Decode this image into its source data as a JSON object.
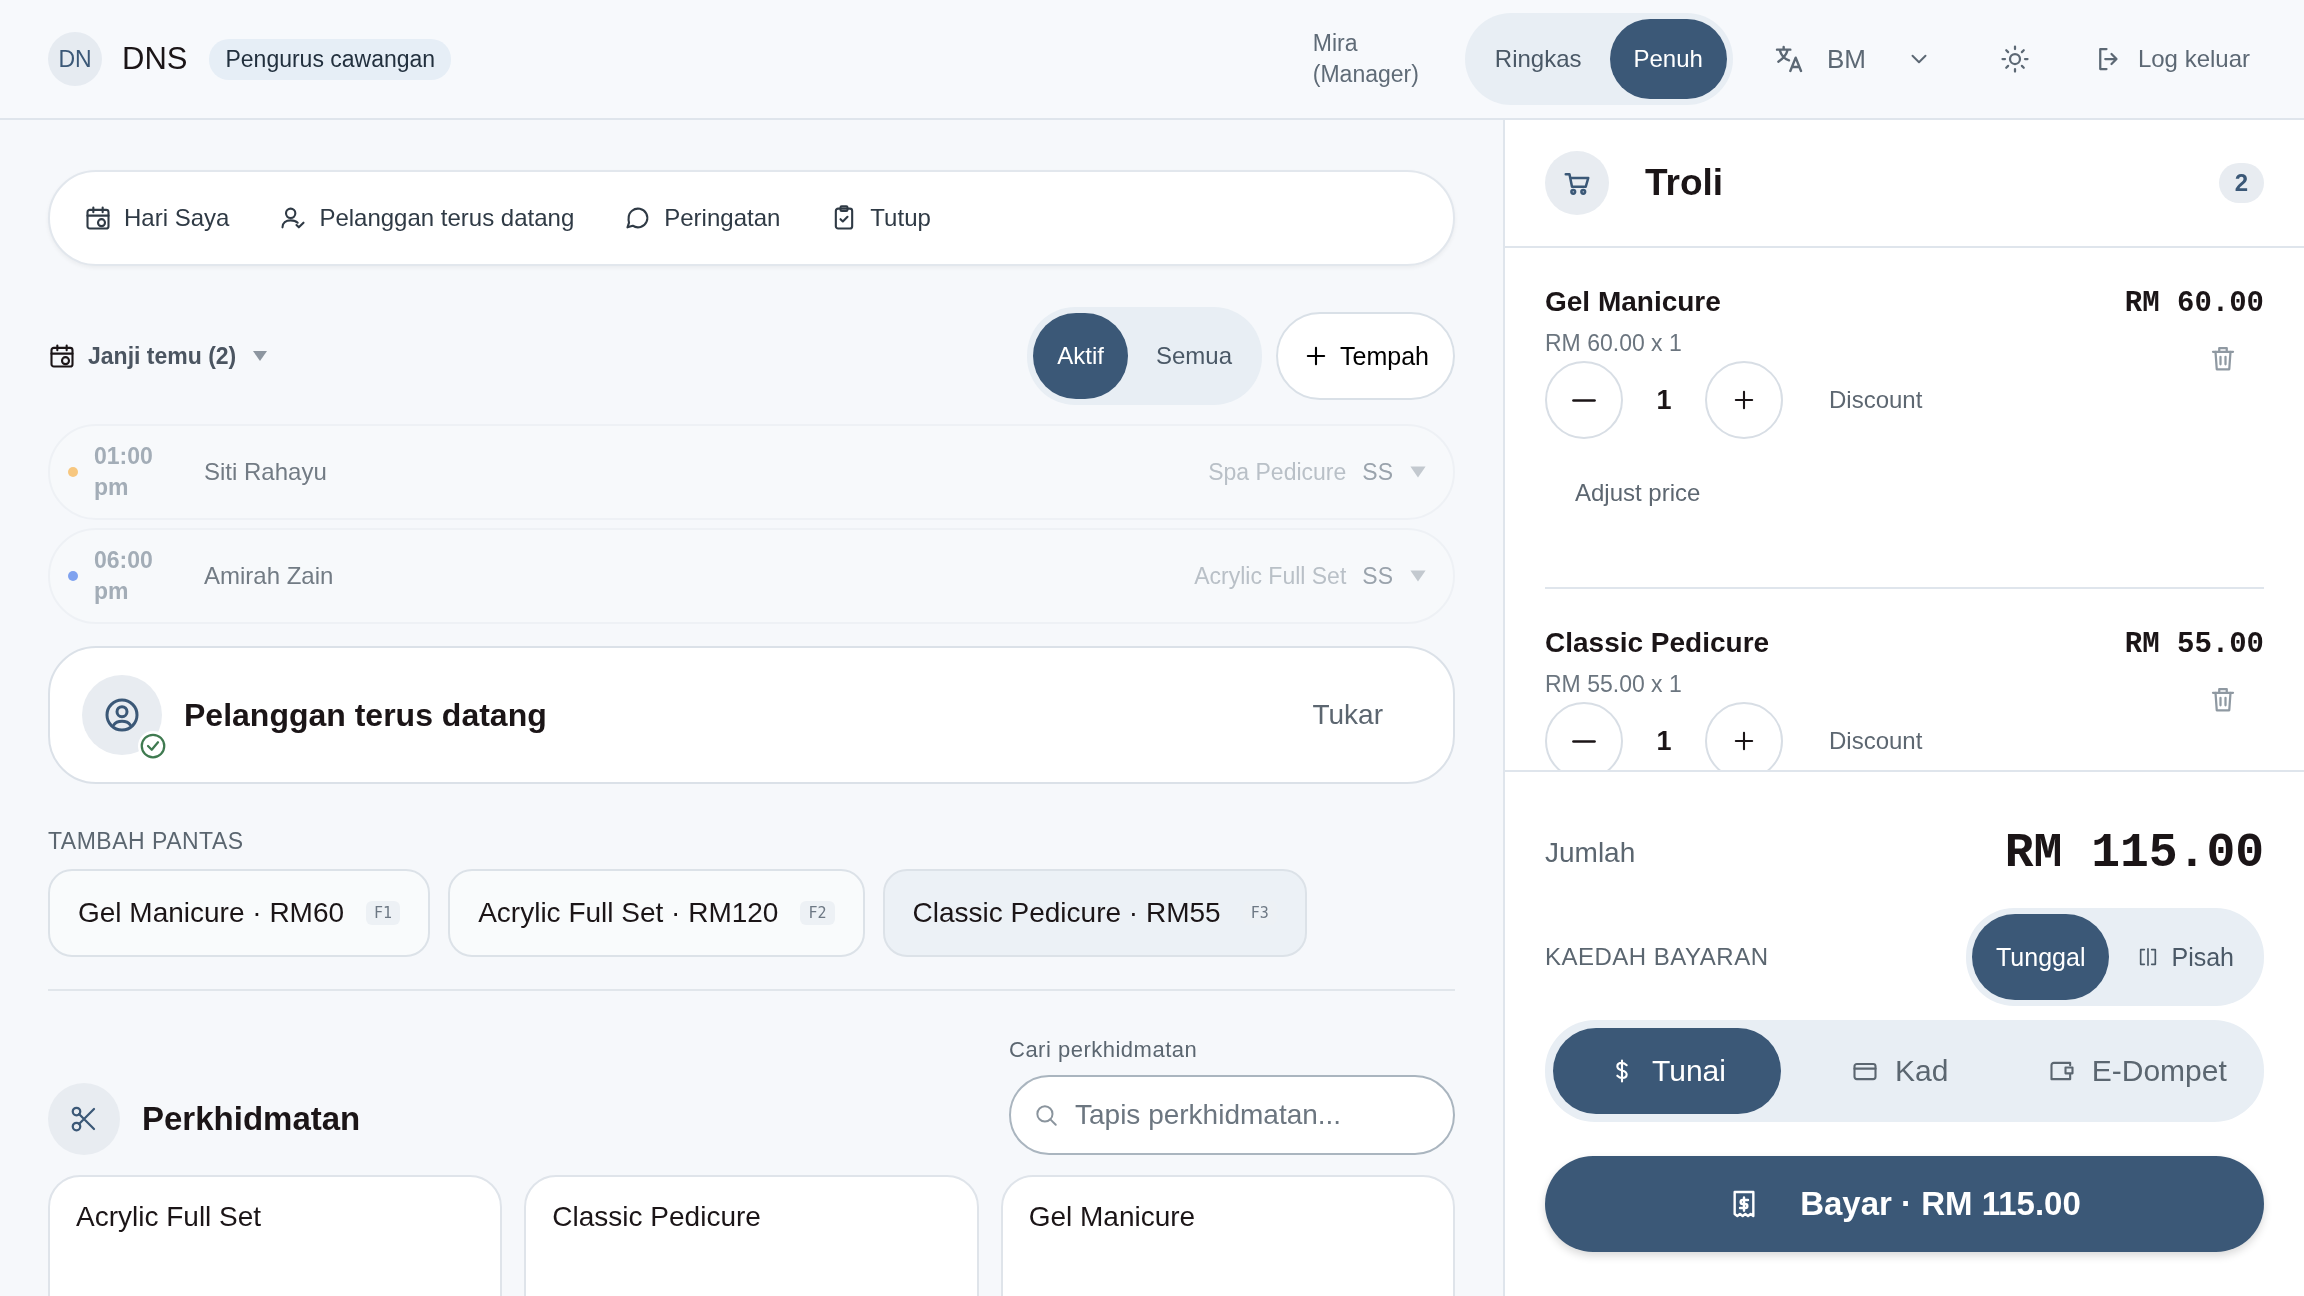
{
  "header": {
    "avatar": "DN",
    "brand": "DNS",
    "role_badge": "Pengurus cawangan",
    "user": "Mira (Manager)",
    "view_toggle": [
      {
        "label": "Ringkas",
        "selected": false
      },
      {
        "label": "Penuh",
        "selected": true
      }
    ],
    "language": "BM",
    "logout": "Log keluar"
  },
  "quick_nav": [
    {
      "label": "Hari Saya"
    },
    {
      "label": "Pelanggan terus datang"
    },
    {
      "label": "Peringatan"
    },
    {
      "label": "Tutup"
    }
  ],
  "appointments": {
    "title": "Janji temu (2)",
    "filters": [
      {
        "label": "Aktif",
        "selected": true
      },
      {
        "label": "Semua",
        "selected": false
      }
    ],
    "book_button": "Tempah",
    "rows": [
      {
        "time": "01:00 pm",
        "name": "Siti Rahayu",
        "service": "Spa Pedicure",
        "staff": "SS",
        "color": "#f7c77f"
      },
      {
        "time": "06:00 pm",
        "name": "Amirah Zain",
        "service": "Acrylic Full Set",
        "staff": "SS",
        "color": "#7fa2ef"
      }
    ]
  },
  "customer": {
    "title": "Pelanggan terus datang",
    "action": "Tukar"
  },
  "quick_add": {
    "title": "TAMBAH PANTAS",
    "items": [
      {
        "label": "Gel Manicure · RM60",
        "key": "F1",
        "selected": false
      },
      {
        "label": "Acrylic Full Set · RM120",
        "key": "F2",
        "selected": false
      },
      {
        "label": "Classic Pedicure · RM55",
        "key": "F3",
        "selected": true
      }
    ]
  },
  "services": {
    "title": "Perkhidmatan",
    "search_label": "Cari perkhidmatan",
    "search_placeholder": "Tapis perkhidmatan...",
    "cards": [
      {
        "name": "Acrylic Full Set"
      },
      {
        "name": "Classic Pedicure"
      },
      {
        "name": "Gel Manicure"
      }
    ]
  },
  "cart": {
    "title": "Troli",
    "count": "2",
    "items": [
      {
        "name": "Gel Manicure",
        "unit": "RM 60.00 x 1",
        "total": "RM 60.00",
        "qty": "1",
        "discount": "Discount",
        "adjust": "Adjust price"
      },
      {
        "name": "Classic Pedicure",
        "unit": "RM 55.00 x 1",
        "total": "RM 55.00",
        "qty": "1",
        "discount": "Discount"
      }
    ],
    "total_label": "Jumlah",
    "total": "RM 115.00",
    "method_label": "KAEDAH BAYARAN",
    "split_toggle": [
      {
        "label": "Tunggal",
        "selected": true
      },
      {
        "label": "Pisah",
        "selected": false
      }
    ],
    "methods": [
      {
        "label": "Tunai",
        "selected": true
      },
      {
        "label": "Kad",
        "selected": false
      },
      {
        "label": "E-Dompet",
        "selected": false
      }
    ],
    "pay_button": "Bayar · RM 115.00"
  }
}
